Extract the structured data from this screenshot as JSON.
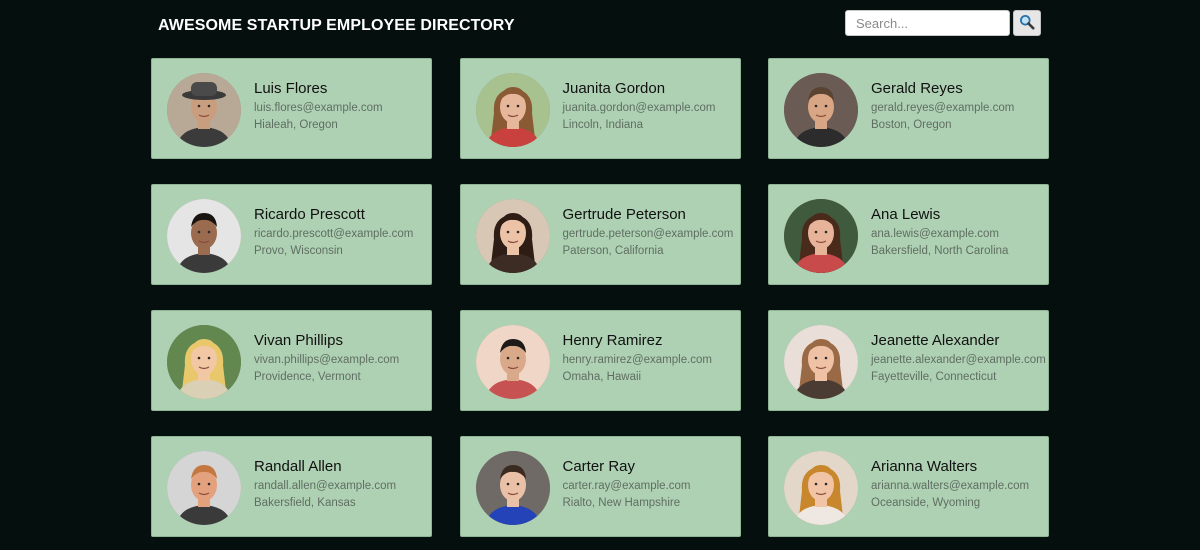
{
  "header": {
    "title": "AWESOME STARTUP EMPLOYEE DIRECTORY",
    "search_placeholder": "Search...",
    "search_value": ""
  },
  "colors": {
    "background": "#050f0e",
    "card_background": "#afd1b3",
    "card_border": "#8fb596",
    "name_text": "#111111",
    "secondary_text": "#5f6e62"
  },
  "employees": [
    {
      "name": "Luis Flores",
      "email": "luis.flores@example.com",
      "location": "Hialeah, Oregon",
      "bg": "#b8a996",
      "skin": "#c99e7e",
      "hair": "#2b2623",
      "shirt": "#3b3b3b",
      "hair_long": false,
      "hat": true
    },
    {
      "name": "Juanita Gordon",
      "email": "juanita.gordon@example.com",
      "location": "Lincoln, Indiana",
      "bg": "#a7c28f",
      "skin": "#e7b79b",
      "hair": "#8a5a35",
      "shirt": "#c9413e",
      "hair_long": true,
      "hat": false
    },
    {
      "name": "Gerald Reyes",
      "email": "gerald.reyes@example.com",
      "location": "Boston, Oregon",
      "bg": "#6b5b55",
      "skin": "#d8a585",
      "hair": "#5a4331",
      "shirt": "#2c2c2c",
      "hair_long": false,
      "hat": false
    },
    {
      "name": "Ricardo Prescott",
      "email": "ricardo.prescott@example.com",
      "location": "Provo, Wisconsin",
      "bg": "#e5e5e5",
      "skin": "#9a6b4e",
      "hair": "#1a1411",
      "shirt": "#3a3a3a",
      "hair_long": false,
      "hat": false
    },
    {
      "name": "Gertrude Peterson",
      "email": "gertrude.peterson@example.com",
      "location": "Paterson, California",
      "bg": "#d8c7b4",
      "skin": "#edc3a8",
      "hair": "#2e1d14",
      "shirt": "#3c2c24",
      "hair_long": true,
      "hat": false
    },
    {
      "name": "Ana Lewis",
      "email": "ana.lewis@example.com",
      "location": "Bakersfield, North Carolina",
      "bg": "#3f5a3c",
      "skin": "#e7b49a",
      "hair": "#4a2a1b",
      "shirt": "#c94a4a",
      "hair_long": true,
      "hat": false
    },
    {
      "name": "Vivan Phillips",
      "email": "vivan.phillips@example.com",
      "location": "Providence, Vermont",
      "bg": "#63884f",
      "skin": "#f1c7a4",
      "hair": "#e8c86b",
      "shirt": "#d9d0b6",
      "hair_long": true,
      "hat": false
    },
    {
      "name": "Henry Ramirez",
      "email": "henry.ramirez@example.com",
      "location": "Omaha, Hawaii",
      "bg": "#f0d6c6",
      "skin": "#d9a98a",
      "hair": "#1e1a18",
      "shirt": "#c65252",
      "hair_long": false,
      "hat": false
    },
    {
      "name": "Jeanette Alexander",
      "email": "jeanette.alexander@example.com",
      "location": "Fayetteville, Connecticut",
      "bg": "#e9dfd8",
      "skin": "#efc2a6",
      "hair": "#9a6a46",
      "shirt": "#4b3c33",
      "hair_long": true,
      "hat": false
    },
    {
      "name": "Randall Allen",
      "email": "randall.allen@example.com",
      "location": "Bakersfield, Kansas",
      "bg": "#d5d5d5",
      "skin": "#e3a27d",
      "hair": "#c4773e",
      "shirt": "#3a3a3a",
      "hair_long": false,
      "hat": false
    },
    {
      "name": "Carter Ray",
      "email": "carter.ray@example.com",
      "location": "Rialto, New Hampshire",
      "bg": "#6f6a66",
      "skin": "#eac1a6",
      "hair": "#3a2a20",
      "shirt": "#2443b8",
      "hair_long": false,
      "hat": false
    },
    {
      "name": "Arianna Walters",
      "email": "arianna.walters@example.com",
      "location": "Oceanside, Wyoming",
      "bg": "#e3d7c9",
      "skin": "#f0c4a4",
      "hair": "#c8872d",
      "shirt": "#efe7e1",
      "hair_long": true,
      "hat": false
    }
  ]
}
